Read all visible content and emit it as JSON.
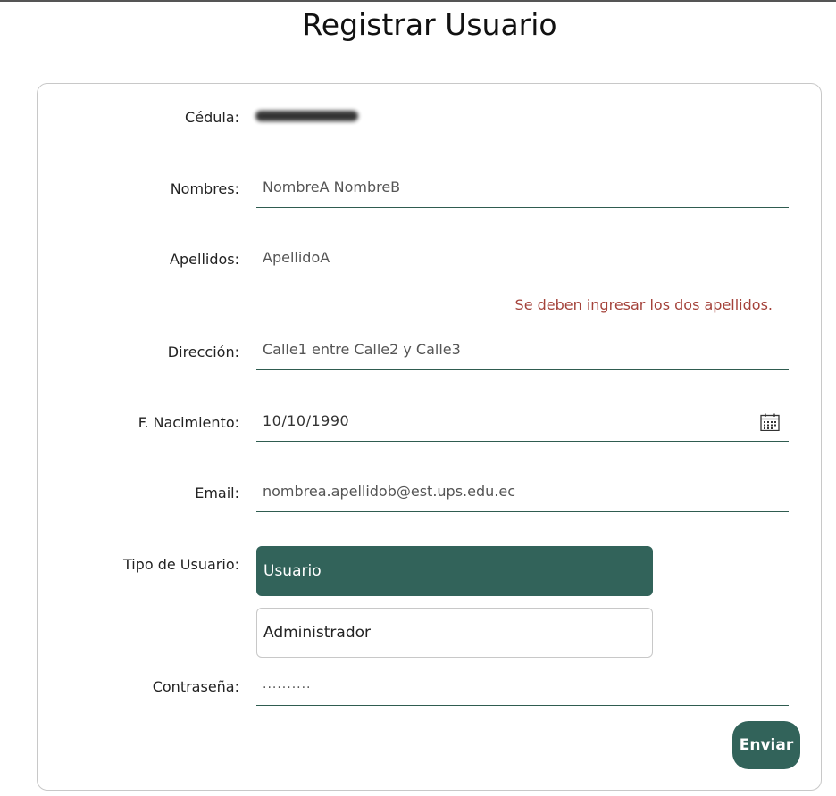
{
  "page": {
    "title": "Registrar Usuario"
  },
  "form": {
    "cedula": {
      "label": "Cédula:",
      "value_redacted": true
    },
    "nombres": {
      "label": "Nombres:",
      "value": "NombreA NombreB"
    },
    "apellidos": {
      "label": "Apellidos:",
      "value": "ApellidoA",
      "error": "Se deben ingresar los dos apellidos."
    },
    "direccion": {
      "label": "Dirección:",
      "value": "Calle1 entre Calle2 y Calle3"
    },
    "nacimiento": {
      "label": "F. Nacimiento:",
      "value": "10/10/1990",
      "icon": "calendar-icon"
    },
    "email": {
      "label": "Email:",
      "value": "nombrea.apellidob@est.ups.edu.ec"
    },
    "tipo_usuario": {
      "label": "Tipo de Usuario:",
      "options": [
        "Usuario",
        "Administrador"
      ],
      "selected": "Usuario"
    },
    "contrasena": {
      "label": "Contraseña:",
      "masked_value": ".........."
    },
    "submit_label": "Enviar"
  },
  "colors": {
    "accent": "#32635a",
    "error": "#a4423a",
    "border": "#c8c8c8"
  }
}
